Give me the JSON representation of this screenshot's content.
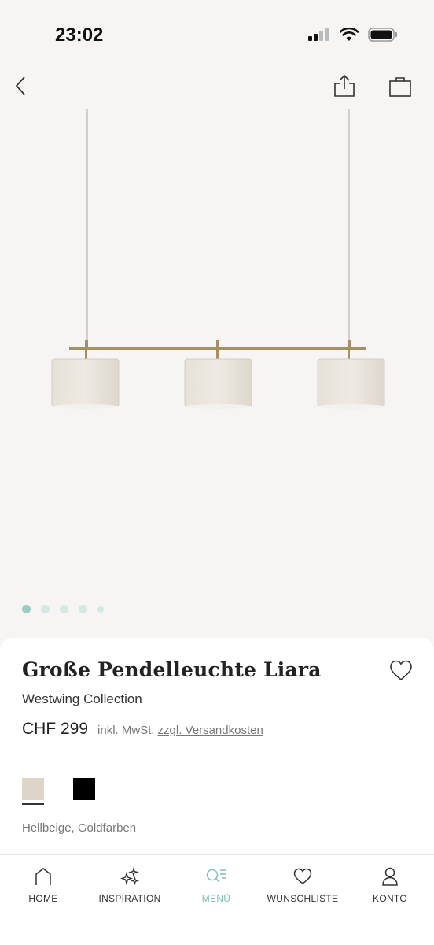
{
  "status_bar": {
    "time": "23:02"
  },
  "product": {
    "title": "Große Pendelleuchte Liara",
    "brand": "Westwing Collection",
    "price": "CHF 299",
    "vat_note": "inkl. MwSt.",
    "shipping_link": "zzgl. Versandkosten",
    "color_name": "Hellbeige, Goldfarben",
    "swatches": [
      {
        "name": "hellbeige",
        "color": "#dcd5c8",
        "selected": true
      },
      {
        "name": "schwarz",
        "color": "#000000",
        "selected": false
      }
    ]
  },
  "gallery": {
    "image_count": 5,
    "active_index": 0
  },
  "tabbar": {
    "items": [
      {
        "label": "HOME",
        "icon": "home-icon"
      },
      {
        "label": "INSPIRATION",
        "icon": "sparkles-icon"
      },
      {
        "label": "MENÜ",
        "icon": "search-menu-icon",
        "active": true
      },
      {
        "label": "WUNSCHLISTE",
        "icon": "heart-icon"
      },
      {
        "label": "KONTO",
        "icon": "user-icon"
      }
    ]
  },
  "colors": {
    "accent": "#7fc0b4",
    "dot_active": "#9fcbc3",
    "dot_inactive": "#d4e8e4"
  }
}
